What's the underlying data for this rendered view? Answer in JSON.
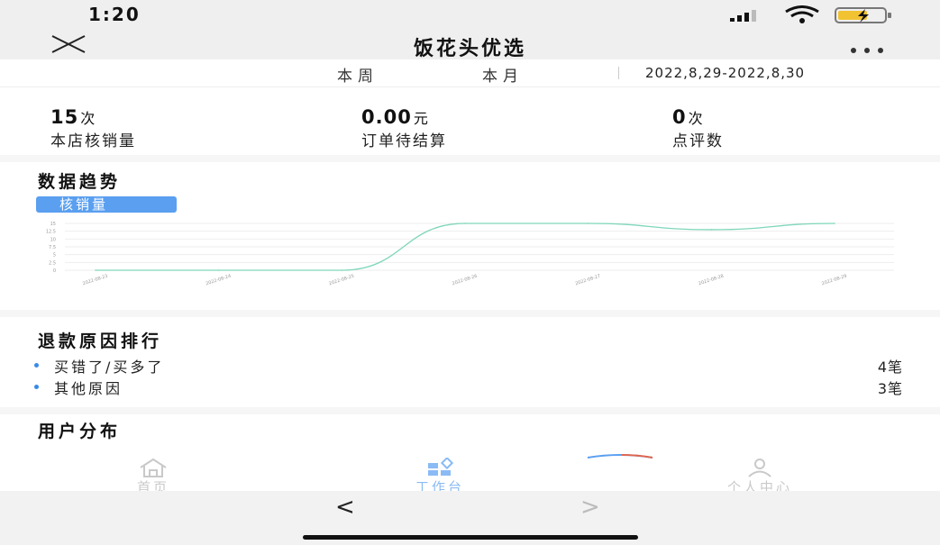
{
  "status": {
    "time": "1:20"
  },
  "nav": {
    "title": "饭花头优选"
  },
  "period": {
    "week": "本周",
    "month": "本月",
    "range": "2022,8,29-2022,8,30"
  },
  "stats": [
    {
      "value": "15",
      "unit": "次",
      "label": "本店核销量"
    },
    {
      "value": "0.00",
      "unit": "元",
      "label": "订单待结算"
    },
    {
      "value": "0",
      "unit": "次",
      "label": "点评数"
    }
  ],
  "trend": {
    "title": "数据趋势",
    "badge": "核销量"
  },
  "chart_data": {
    "type": "line",
    "x": [
      "2022-08-23",
      "2022-08-24",
      "2022-08-25",
      "2022-08-26",
      "2022-08-27",
      "2022-08-28",
      "2022-08-29"
    ],
    "series": [
      {
        "values": [
          0,
          0,
          0,
          15,
          15,
          13,
          15
        ]
      }
    ],
    "ylim": [
      0,
      15
    ],
    "yticks": [
      "15",
      "12.5",
      "10",
      "7.5",
      "5",
      "2.5",
      "0"
    ],
    "xticks": [
      "2022-08-23",
      "2022-08-24",
      "2022-08-25",
      "2022-08-26",
      "2022-08-27",
      "2022-08-28",
      "2022-08-29"
    ],
    "grid": true,
    "colors": {
      "line": "#7fd6bb",
      "grid": "#eeeeee"
    }
  },
  "refunds": {
    "title": "退款原因排行",
    "items": [
      {
        "label": "买错了/买多了",
        "count": "4笔"
      },
      {
        "label": "其他原因",
        "count": "3笔"
      }
    ]
  },
  "users": {
    "title": "用户分布"
  },
  "tabbar": {
    "home": "首页",
    "workbench": "工作台",
    "profile": "个人中心"
  },
  "colors": {
    "accent": "#5a9ff0",
    "muted": "#c9c9c9"
  }
}
